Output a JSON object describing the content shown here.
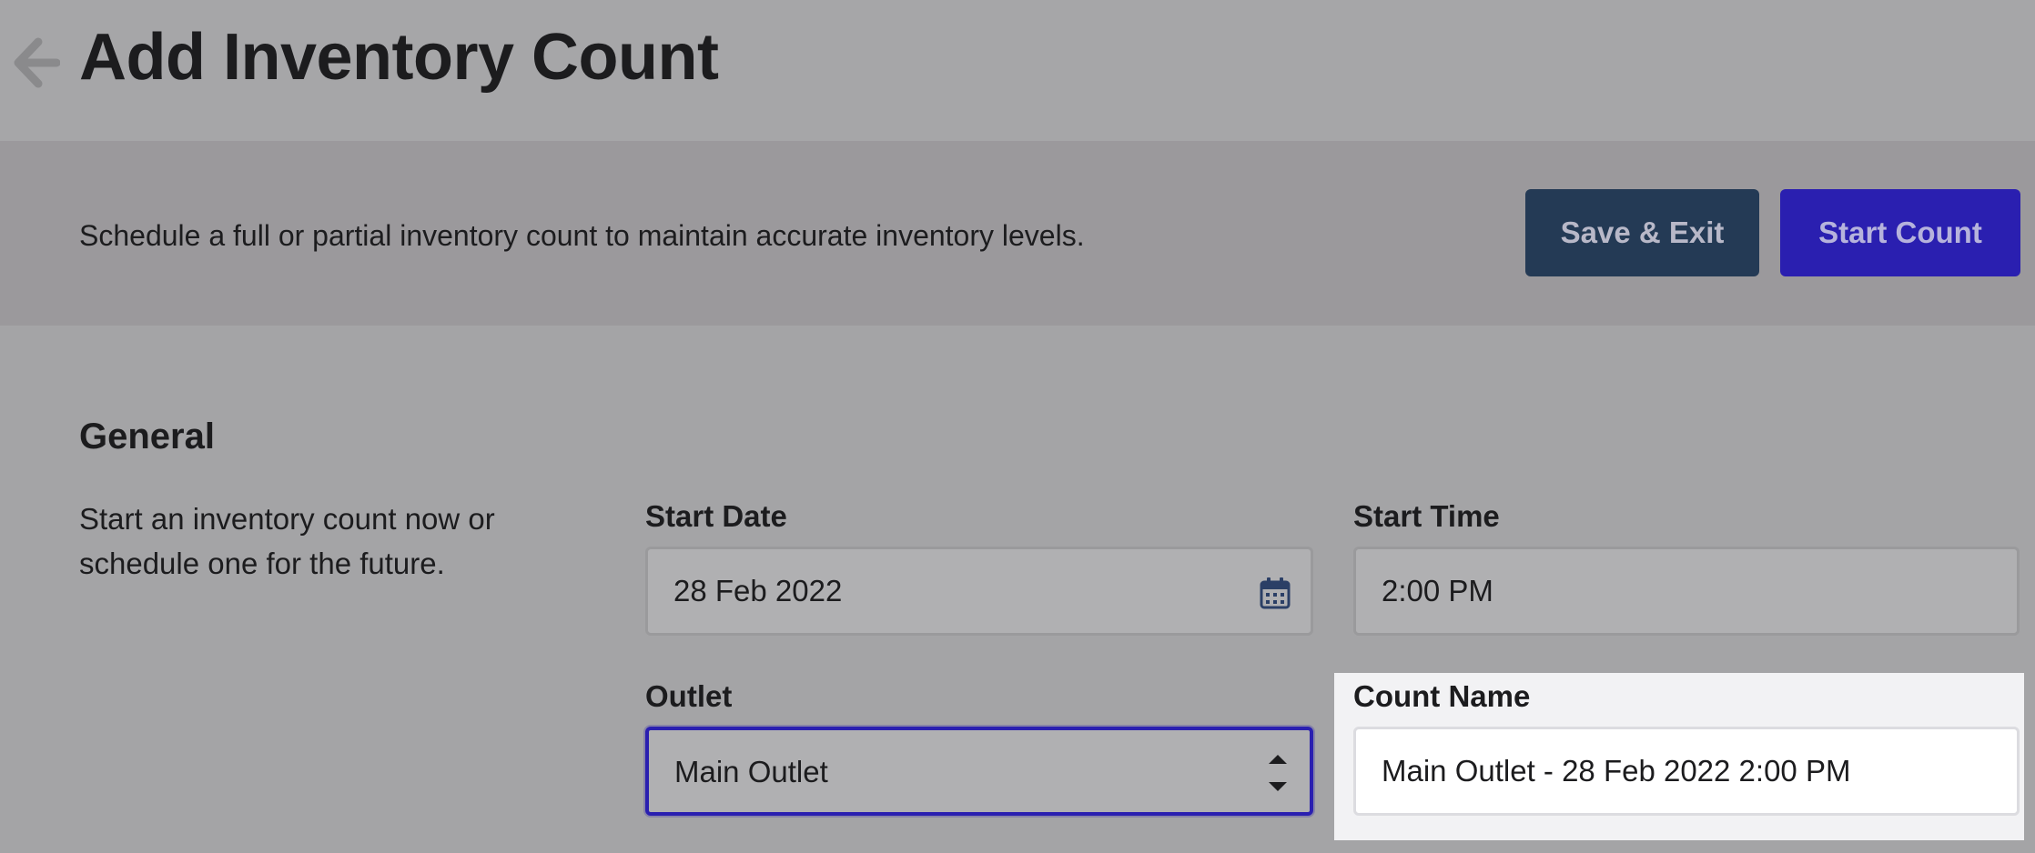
{
  "header": {
    "title": "Add Inventory Count",
    "back_icon": "arrow-left-icon"
  },
  "banner": {
    "description": "Schedule a full or partial inventory count to maintain accurate inventory levels.",
    "save_exit_label": "Save & Exit",
    "start_count_label": "Start Count"
  },
  "general": {
    "title": "General",
    "description": "Start an inventory count now or schedule one for the future.",
    "start_date": {
      "label": "Start Date",
      "value": "28 Feb 2022",
      "icon": "calendar-icon"
    },
    "start_time": {
      "label": "Start Time",
      "value": "2:00 PM"
    },
    "outlet": {
      "label": "Outlet",
      "value": "Main Outlet",
      "icon": "stepper-icon"
    },
    "count_name": {
      "label": "Count Name",
      "value": "Main Outlet - 28 Feb 2022 2:00 PM"
    }
  },
  "colors": {
    "primary_button": "#2a1fb0",
    "secondary_button": "#243a55",
    "focus_ring": "#2a1fb0"
  }
}
